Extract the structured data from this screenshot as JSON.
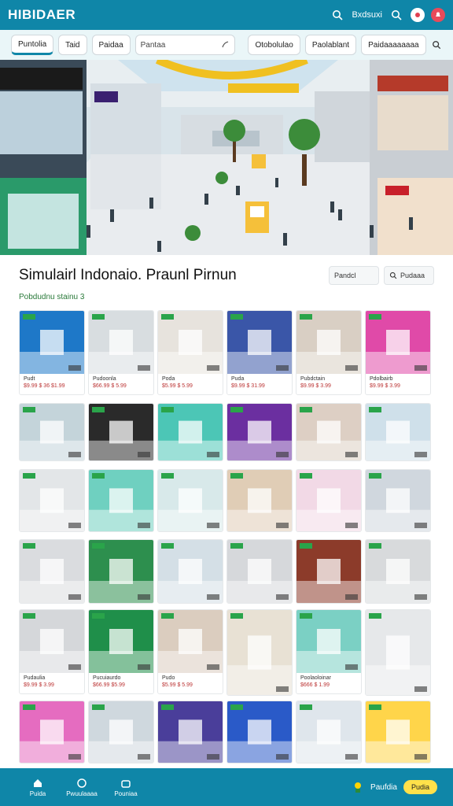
{
  "header": {
    "logo": "HIBIDAER",
    "link": "Bxdsuxi",
    "colors": {
      "bar": "#0f86a8",
      "accent": "#ffd400"
    }
  },
  "filters": {
    "chips": [
      "Puntolia",
      "Taid",
      "Paidaa"
    ],
    "search_value": "Pantaa",
    "right_chips": [
      "Otobolulao",
      "Paolablant",
      "Paidaaaaaaaa"
    ]
  },
  "title_row": {
    "title": "Simulairl Indonaio. Praunl Pirnun",
    "box1": "Pandcl",
    "box2": "Pudaaa"
  },
  "subtitle": "Pobdudnu stainu 3",
  "cards": [
    {
      "l1": "Pudt",
      "l2": "$9.99 $ 36 $1.99",
      "color": "#1e78c8"
    },
    {
      "l1": "Pudoonla",
      "l2": "$66.99 $ 5.99",
      "color": "#d8dde0"
    },
    {
      "l1": "Poda",
      "l2": "$5.99 $ 5.99",
      "color": "#e7e3dd"
    },
    {
      "l1": "Puda",
      "l2": "$9.99 $ 31.99",
      "color": "#3a56a8"
    },
    {
      "l1": "Pubdctain",
      "l2": "$9.99 $ 3.99",
      "color": "#d9cfc4"
    },
    {
      "l1": "Pdolbairb",
      "l2": "$9.99 $ 3.99",
      "color": "#e04aa8"
    },
    {
      "l1": "",
      "l2": "",
      "color": "#c4d4da"
    },
    {
      "l1": "",
      "l2": "",
      "color": "#2a2a2a"
    },
    {
      "l1": "",
      "l2": "",
      "color": "#4cc6b6"
    },
    {
      "l1": "",
      "l2": "",
      "color": "#6b2fa0"
    },
    {
      "l1": "",
      "l2": "",
      "color": "#ddcfc4"
    },
    {
      "l1": "",
      "l2": "",
      "color": "#cfe0ea"
    },
    {
      "l1": "",
      "l2": "",
      "color": "#e3e6e8"
    },
    {
      "l1": "",
      "l2": "",
      "color": "#6fd0c0"
    },
    {
      "l1": "",
      "l2": "",
      "color": "#d8e9ea"
    },
    {
      "l1": "",
      "l2": "",
      "color": "#e0cdb6"
    },
    {
      "l1": "",
      "l2": "",
      "color": "#f2d9e6"
    },
    {
      "l1": "",
      "l2": "",
      "color": "#d0d7de"
    },
    {
      "l1": "",
      "l2": "",
      "color": "#dadcdf"
    },
    {
      "l1": "",
      "l2": "",
      "color": "#2d8f4e"
    },
    {
      "l1": "",
      "l2": "",
      "color": "#d4dfe6"
    },
    {
      "l1": "",
      "l2": "",
      "color": "#d6d8db"
    },
    {
      "l1": "",
      "l2": "",
      "color": "#8c3b2a"
    },
    {
      "l1": "",
      "l2": "",
      "color": "#d8dadc"
    },
    {
      "l1": "Pudaulia",
      "l2": "$9.99 $ 3.99",
      "color": "#d5d7da"
    },
    {
      "l1": "Pucuiaurdo",
      "l2": "$66.99 $5.99",
      "color": "#1f8f4a"
    },
    {
      "l1": "Pudo",
      "l2": "$5.99 $ 5.99",
      "color": "#dbcdbf"
    },
    {
      "l1": "",
      "l2": "",
      "color": "#e8e1d4"
    },
    {
      "l1": "Poolaoloinar",
      "l2": "$666 $ 1.99",
      "color": "#7bd0c4"
    },
    {
      "l1": "",
      "l2": "",
      "color": "#e6e8ea"
    },
    {
      "l1": "",
      "l2": "",
      "color": "#e56cc0"
    },
    {
      "l1": "",
      "l2": "",
      "color": "#cfd8de"
    },
    {
      "l1": "",
      "l2": "",
      "color": "#4a3e9a"
    },
    {
      "l1": "",
      "l2": "",
      "color": "#2a5ac8"
    },
    {
      "l1": "",
      "l2": "",
      "color": "#dfe6ec"
    },
    {
      "l1": "",
      "l2": "",
      "color": "#ffd54a"
    }
  ],
  "bottomnav": {
    "items": [
      "Puida",
      "Pwuulaaaa",
      "Pouniaa"
    ],
    "right_text": "Paufdia",
    "right_button": "Pudia"
  }
}
